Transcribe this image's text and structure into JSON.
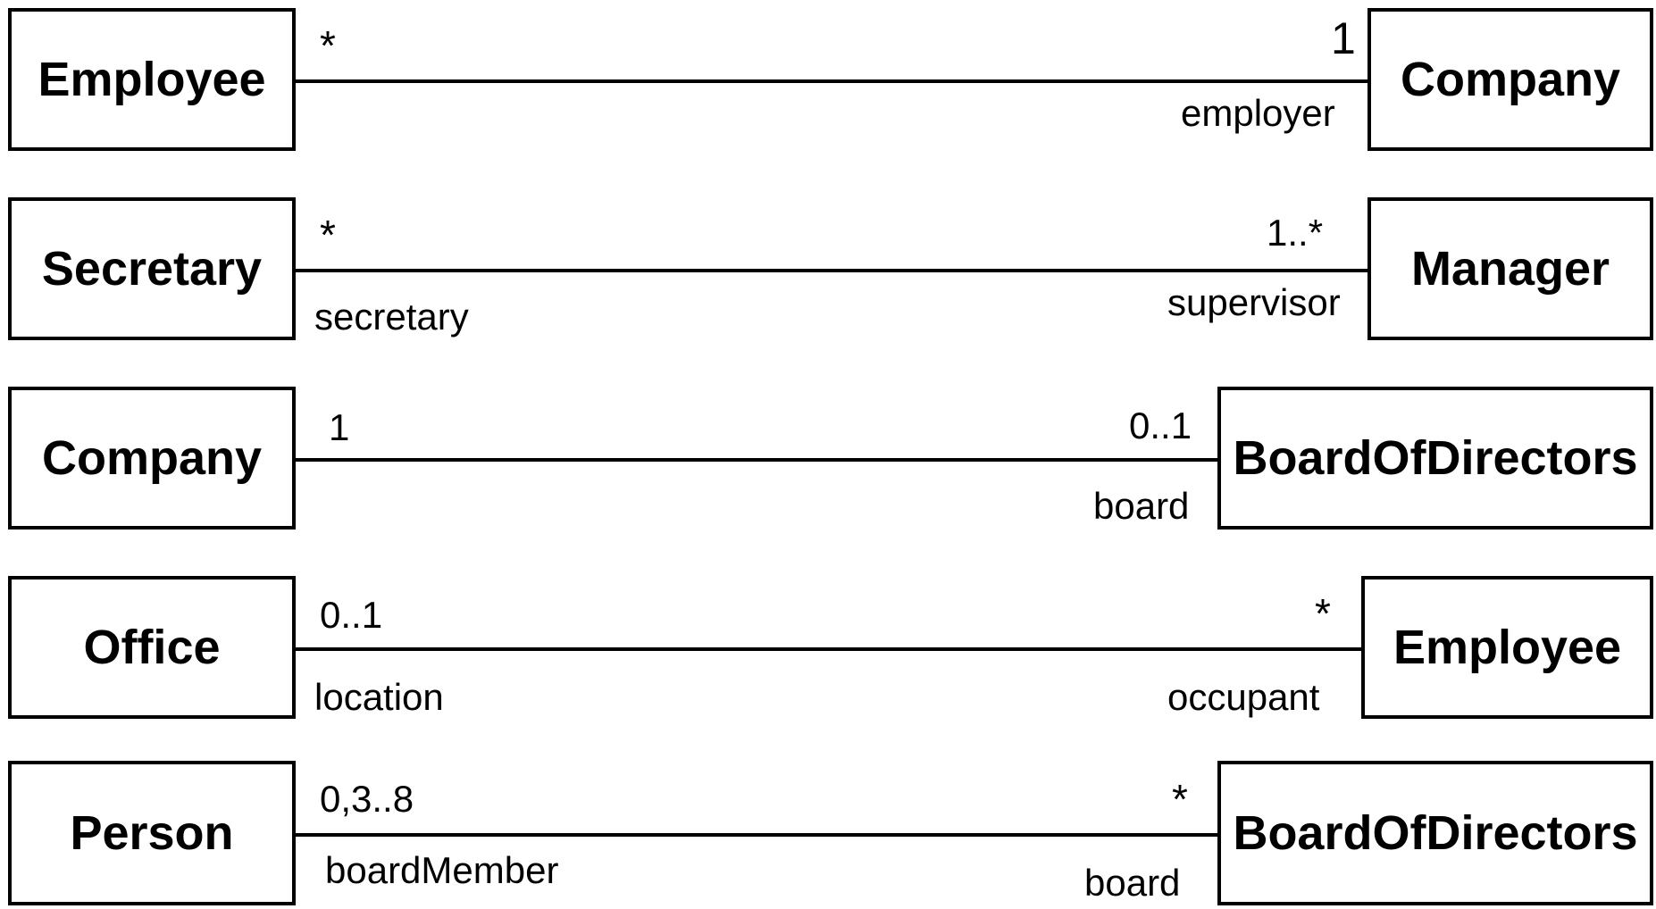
{
  "associations": [
    {
      "left_class": "Employee",
      "right_class": "Company",
      "left_multiplicity": "*",
      "right_multiplicity": "1",
      "left_role": "",
      "right_role": "employer"
    },
    {
      "left_class": "Secretary",
      "right_class": "Manager",
      "left_multiplicity": "*",
      "right_multiplicity": "1..*",
      "left_role": "secretary",
      "right_role": "supervisor"
    },
    {
      "left_class": "Company",
      "right_class": "BoardOfDirectors",
      "left_multiplicity": "1",
      "right_multiplicity": "0..1",
      "left_role": "",
      "right_role": "board"
    },
    {
      "left_class": "Office",
      "right_class": "Employee",
      "left_multiplicity": "0..1",
      "right_multiplicity": "*",
      "left_role": "location",
      "right_role": "occupant"
    },
    {
      "left_class": "Person",
      "right_class": "BoardOfDirectors",
      "left_multiplicity": "0,3..8",
      "right_multiplicity": "*",
      "left_role": "boardMember",
      "right_role": "board"
    }
  ]
}
